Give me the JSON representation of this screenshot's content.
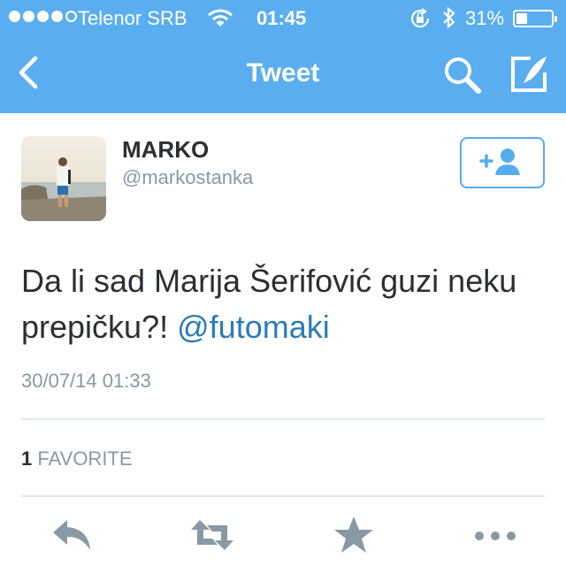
{
  "status_bar": {
    "carrier": "Telenor SRB",
    "time": "01:45",
    "battery": "31%",
    "battery_level": 0.31
  },
  "nav": {
    "title": "Tweet",
    "icons": [
      "back-chevron-icon",
      "search-icon",
      "compose-icon"
    ]
  },
  "tweet": {
    "author_name": "MARKO",
    "author_handle": "@markostanka",
    "text": "Da li sad Marija Šerifović guzi neku prepičku?!",
    "mention": "@futomaki",
    "timestamp": "30/07/14 01:33",
    "favorites_count": "1",
    "favorites_label": "FAVORITE"
  },
  "actions": [
    "reply-icon",
    "retweet-icon",
    "favorite-icon",
    "more-icon"
  ],
  "colors": {
    "header": "#5aaef0",
    "link": "#2b7bb9",
    "muted": "#8899a6",
    "text": "#292f33",
    "icon": "#8899a6",
    "divider": "#e1e8ed"
  }
}
